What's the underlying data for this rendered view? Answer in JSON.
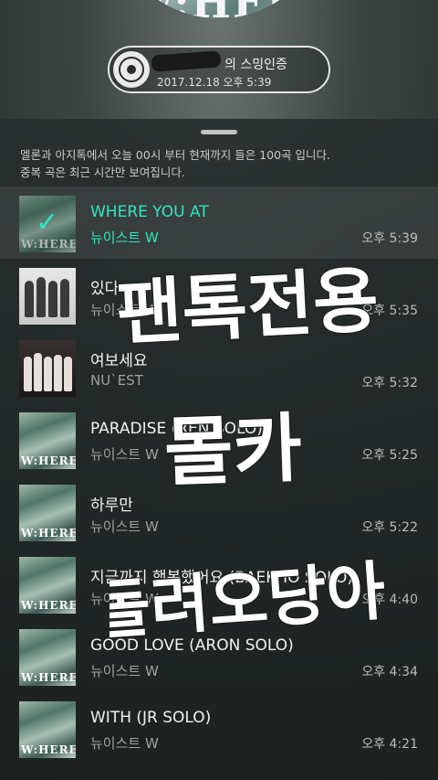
{
  "header": {
    "cover_text": "W:HERE",
    "streaming_label": "의 스밍인증",
    "streaming_datetime": "2017.12.18 오후 5:39"
  },
  "notice": {
    "line1": "멜론과 아지톡에서 오늘 00시 부터 현재까지 들은 100곡 입니다.",
    "line2": "중복 곡은 최근 시간만 보여집니다."
  },
  "songs": [
    {
      "title": "WHERE YOU AT",
      "artist": "뉴이스트 W",
      "time": "오후 5:39",
      "cover": "where",
      "active": true
    },
    {
      "title": "있다",
      "artist": "뉴이스트 W",
      "time": "오후 5:35",
      "cover": "bw",
      "active": false
    },
    {
      "title": "여보세요",
      "artist": "NU`EST",
      "time": "오후 5:32",
      "cover": "dark",
      "active": false
    },
    {
      "title": "PARADISE (REN SOLO)",
      "artist": "뉴이스트 W",
      "time": "오후 5:25",
      "cover": "where",
      "active": false
    },
    {
      "title": "하루만",
      "artist": "뉴이스트 W",
      "time": "오후 5:22",
      "cover": "where",
      "active": false
    },
    {
      "title": "지금까지 행복했어요 (BAEKHO SOLO)",
      "artist": "뉴이스트 W",
      "time": "오후 4:40",
      "cover": "where",
      "active": false
    },
    {
      "title": "GOOD LOVE (ARON SOLO)",
      "artist": "뉴이스트 W",
      "time": "오후 4:34",
      "cover": "where",
      "active": false
    },
    {
      "title": "WITH (JR SOLO)",
      "artist": "뉴이스트 W",
      "time": "오후 4:21",
      "cover": "where",
      "active": false
    }
  ],
  "overlay_text": {
    "line1": "팬톡전용",
    "line2": "몰카",
    "line3": "돌려오당아"
  },
  "colors": {
    "accent": "#2ee6c4",
    "background": "#2f3533"
  },
  "icons": {
    "disc": "vinyl-disc-icon",
    "check": "checkmark-icon"
  }
}
